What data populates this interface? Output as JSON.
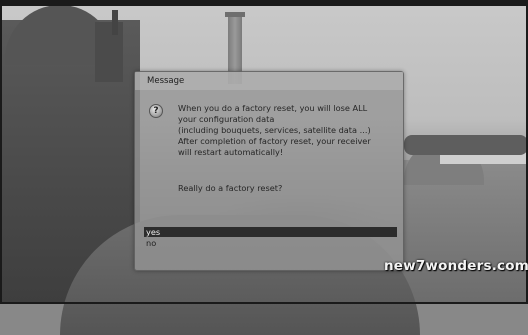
{
  "dialog": {
    "title": "Message",
    "icon": "question-icon",
    "icon_glyph": "?",
    "message_lines": [
      "When you do a factory reset, you will lose ALL",
      "your configuration data",
      "(including bouquets, services, satellite data ...)",
      "After completion of factory reset, your receiver",
      "will restart automatically!"
    ],
    "question": "Really do a factory reset?",
    "options": [
      {
        "label": "yes",
        "selected": true
      },
      {
        "label": "no",
        "selected": false
      }
    ]
  },
  "watermark": "new7wonders.com",
  "colors": {
    "selected_bg": "#2c2c2c",
    "selected_text": "#eeeeee",
    "dialog_bg": "#969696"
  }
}
